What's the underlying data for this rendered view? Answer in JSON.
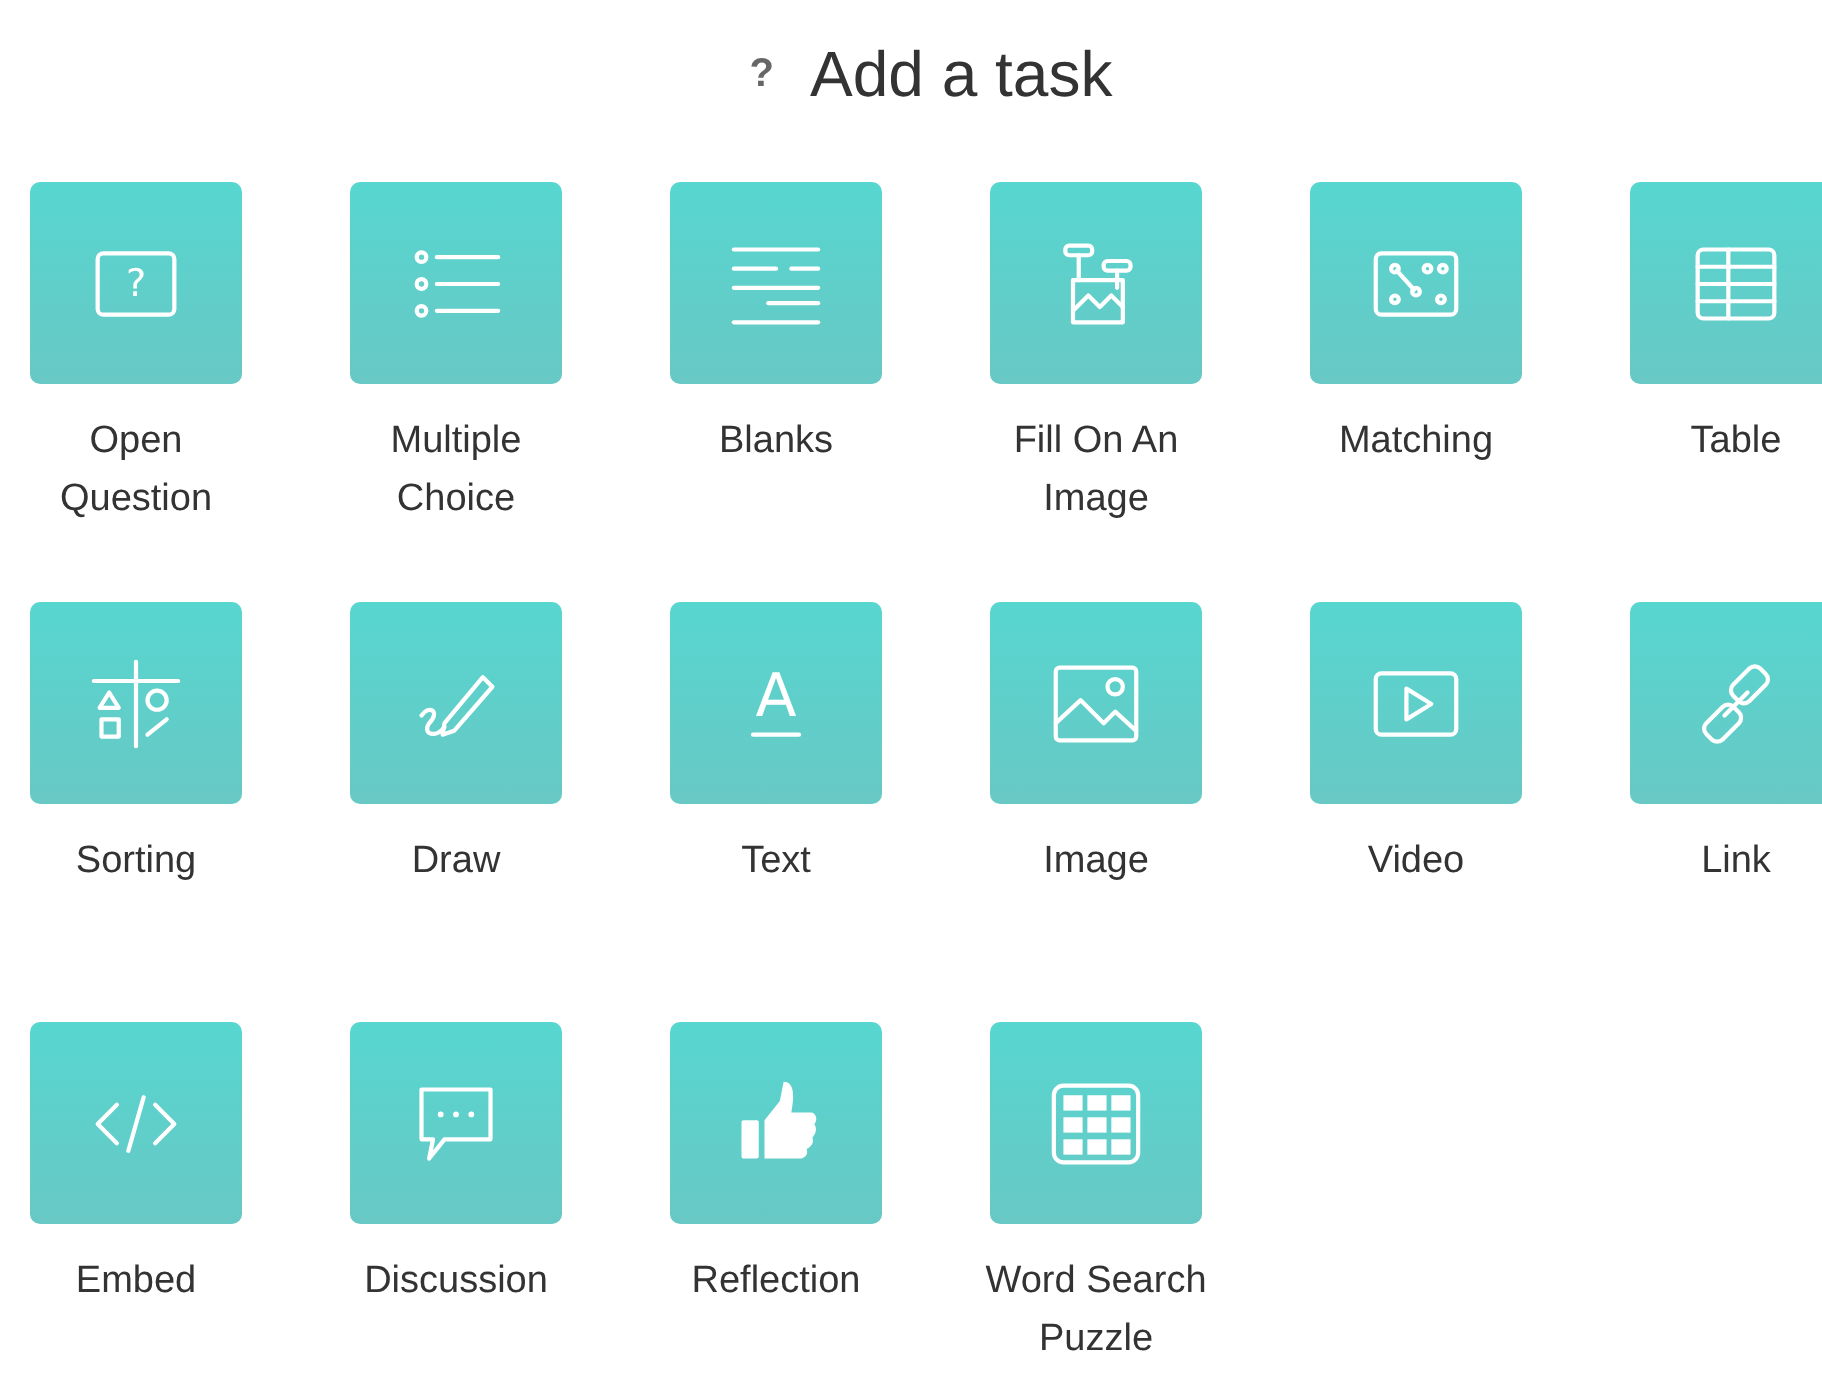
{
  "header": {
    "help_icon": "?",
    "title": "Add a task"
  },
  "tasks": [
    {
      "kind": "open-question",
      "label": "Open Question",
      "glyph": "?"
    },
    {
      "kind": "multiple-choice",
      "label": "Multiple Choice"
    },
    {
      "kind": "blanks",
      "label": "Blanks"
    },
    {
      "kind": "fill-image",
      "label": "Fill On An Image"
    },
    {
      "kind": "matching",
      "label": "Matching"
    },
    {
      "kind": "table",
      "label": "Table"
    },
    {
      "kind": "sorting",
      "label": "Sorting"
    },
    {
      "kind": "draw",
      "label": "Draw"
    },
    {
      "kind": "text",
      "label": "Text",
      "glyph": "A"
    },
    {
      "kind": "image",
      "label": "Image"
    },
    {
      "kind": "video",
      "label": "Video"
    },
    {
      "kind": "link",
      "label": "Link"
    },
    {
      "kind": "embed",
      "label": "Embed"
    },
    {
      "kind": "discussion",
      "label": "Discussion"
    },
    {
      "kind": "reflection",
      "label": "Reflection"
    },
    {
      "kind": "word-search",
      "label": "Word Search Puzzle"
    }
  ]
}
